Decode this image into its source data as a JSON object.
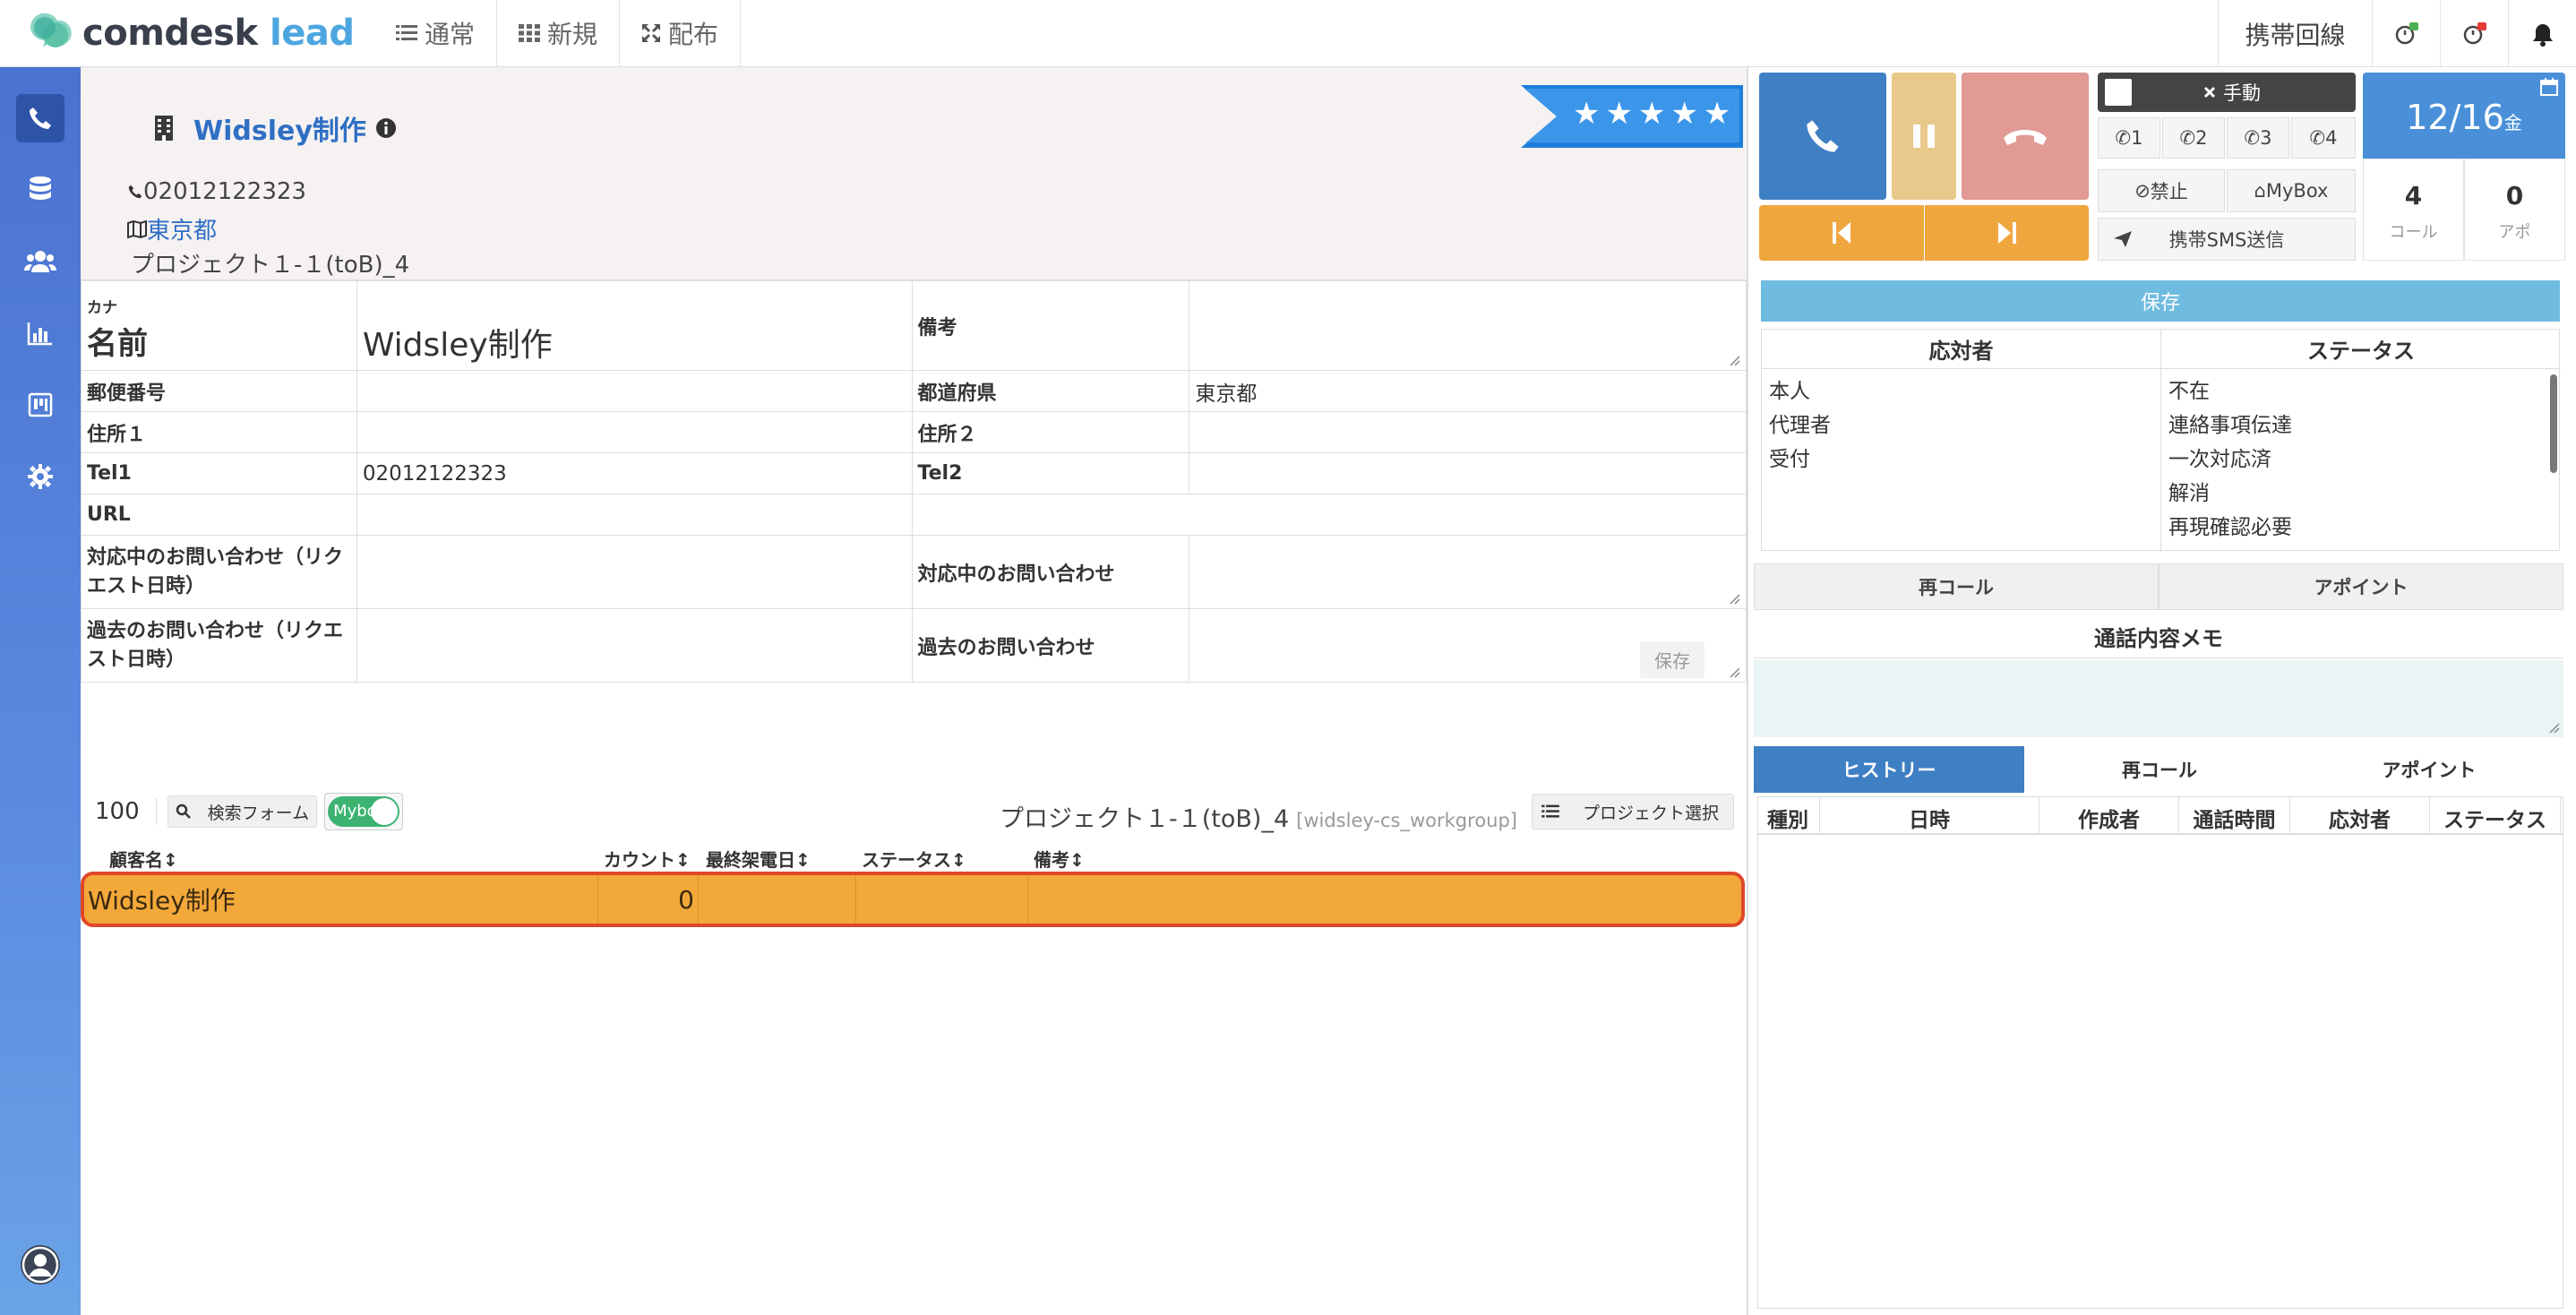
{
  "app": {
    "brand_main": "comdesk",
    "brand_accent": "lead"
  },
  "topnav": {
    "items": [
      {
        "label": "通常"
      },
      {
        "label": "新規"
      },
      {
        "label": "配布"
      }
    ],
    "mobile_line": "携帯回線"
  },
  "customer": {
    "title": "Widsley制作",
    "phone": "02012122323",
    "prefecture": "東京都",
    "project": "プロジェクト１-１(toB)_4",
    "rating_stars": "★★★★★"
  },
  "info": {
    "kana_label": "カナ",
    "name_label": "名前",
    "name_value": "Widsley制作",
    "memo_label": "備考",
    "zip_label": "郵便番号",
    "pref_label": "都道府県",
    "pref_value": "東京都",
    "addr1_label": "住所１",
    "addr2_label": "住所２",
    "tel1_label": "Tel1",
    "tel1_value": "02012122323",
    "tel2_label": "Tel2",
    "url_label": "URL",
    "cur_inq_date_label": "対応中のお問い合わせ（リクエスト日時）",
    "cur_inq_label": "対応中のお問い合わせ",
    "past_inq_date_label": "過去のお問い合わせ（リクエスト日時）",
    "past_inq_label": "過去のお問い合わせ",
    "save_label": "保存"
  },
  "list": {
    "count": "100",
    "search_label": "検索フォーム",
    "toggle_label": "Mybo",
    "project_name": "プロジェクト１-１(toB)_4",
    "workgroup": "[widsley-cs_workgroup]",
    "project_select": "プロジェクト選択",
    "columns": [
      "顧客名",
      "カウント",
      "最終架電日",
      "ステータス",
      "備考"
    ],
    "rows": [
      {
        "name": "Widsley制作",
        "count": "0",
        "last": "",
        "status": "",
        "memo": ""
      }
    ]
  },
  "phone": {
    "manual": "手動",
    "lines": [
      "1",
      "2",
      "3",
      "4"
    ],
    "block": "禁止",
    "mybox": "MyBox",
    "sms": "携帯SMS送信",
    "date": "12/16",
    "weekday": "金",
    "calls_value": "4",
    "calls_label": "コール",
    "appo_value": "0",
    "appo_label": "アポ"
  },
  "result": {
    "save": "保存",
    "responder_header": "応対者",
    "status_header": "ステータス",
    "responders": [
      "本人",
      "代理者",
      "受付"
    ],
    "statuses": [
      "不在",
      "連絡事項伝達",
      "一次対応済",
      "解消",
      "再現確認必要"
    ],
    "recall": "再コール",
    "appoint": "アポイント",
    "memo_title": "通話内容メモ"
  },
  "history": {
    "tabs": [
      "ヒストリー",
      "再コール",
      "アポイント"
    ],
    "columns": [
      "種別",
      "日時",
      "作成者",
      "通話時間",
      "応対者",
      "ステータス"
    ]
  },
  "colors": {
    "sidebar": "#4a72cf",
    "call_green": "#3f7fc4",
    "pause": "#e9c88c",
    "hangup": "#e19a94",
    "skip": "#f0a63f",
    "date_panel": "#4a90d9",
    "highlight_row": "#f3a83a",
    "highlight_border": "#e0472a",
    "save_bar": "#6fbce0"
  }
}
